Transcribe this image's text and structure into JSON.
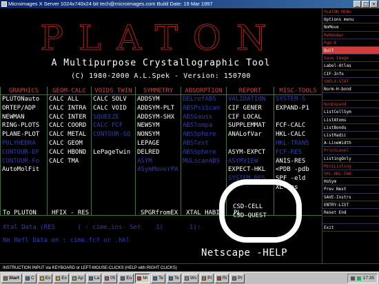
{
  "window": {
    "title": "Microimages X Server   1024x740x24 bit   tech@microimages.com  Build Date: 19 Mar 1997",
    "min": "_",
    "max": "□",
    "close": "×"
  },
  "banner": {
    "title": "PLATON",
    "subtitle": "A Multipurpose Crystallographic Tool",
    "copyright": "(C) 1980-2000 A.L.Spek - Version: 150700"
  },
  "columns": [
    {
      "header": "GRAPHICS",
      "items": [
        {
          "label": "PLUTONauto",
          "dim": false
        },
        {
          "label": "ORTEP/ADP",
          "dim": false
        },
        {
          "label": "NEWMAN",
          "dim": false
        },
        {
          "label": "RING-PLOTS",
          "dim": false
        },
        {
          "label": "PLANE-PLOT",
          "dim": false
        },
        {
          "label": "POLYHEDRA",
          "dim": true
        },
        {
          "label": "CONTOUR-DF",
          "dim": true
        },
        {
          "label": "CONTOUR-Fo",
          "dim": true
        },
        {
          "label": "AutoMolFit",
          "dim": false
        }
      ]
    },
    {
      "header": "GEOM-CALC",
      "items": [
        {
          "label": "CALC ALL",
          "dim": false
        },
        {
          "label": "CALC INTRA",
          "dim": false
        },
        {
          "label": "CALC INTER",
          "dim": false
        },
        {
          "label": "CALC COORD",
          "dim": false
        },
        {
          "label": "CALC METAL",
          "dim": false
        },
        {
          "label": "CALC GEOM",
          "dim": false
        },
        {
          "label": "CALC HBOND",
          "dim": false
        },
        {
          "label": "CALC TMA",
          "dim": false
        }
      ]
    },
    {
      "header": "VOIDS TWIN",
      "items": [
        {
          "label": "CALC SOLV",
          "dim": false
        },
        {
          "label": "CALC VOID",
          "dim": false
        },
        {
          "label": "SQUEEZE",
          "dim": true
        },
        {
          "label": "CALC FCF",
          "dim": true
        },
        {
          "label": "CONTOUR-SQ",
          "dim": true
        },
        {
          "label": "",
          "dim": false
        },
        {
          "label": "LePageTwin",
          "dim": false
        }
      ]
    },
    {
      "header": "SYMMETRY",
      "items": [
        {
          "label": "ADDSYM",
          "dim": false
        },
        {
          "label": "ADDSYM-PLT",
          "dim": false
        },
        {
          "label": "ADDSYM-SHX",
          "dim": false
        },
        {
          "label": "NEWSYM",
          "dim": false
        },
        {
          "label": "NONSYM",
          "dim": false
        },
        {
          "label": "LEPAGE",
          "dim": false
        },
        {
          "label": "DELRED",
          "dim": false
        },
        {
          "label": "ASYM",
          "dim": true
        },
        {
          "label": "ASymMoverPA",
          "dim": true
        }
      ]
    },
    {
      "header": "ABSORPTION",
      "items": [
        {
          "label": "DELrefABS",
          "dim": true
        },
        {
          "label": "ABSPsiScan",
          "dim": true
        },
        {
          "label": "ABSGauss",
          "dim": true
        },
        {
          "label": "ABSTompa",
          "dim": true
        },
        {
          "label": "ABSSphere",
          "dim": true
        },
        {
          "label": "ABSTest",
          "dim": true
        },
        {
          "label": "ABSSphere",
          "dim": true
        },
        {
          "label": "MULscanABS",
          "dim": true
        }
      ]
    },
    {
      "header": "REPORT",
      "items": [
        {
          "label": "VALIDATION",
          "dim": true
        },
        {
          "label": "CIF GENER",
          "dim": false
        },
        {
          "label": "CIF LOCAL",
          "dim": false
        },
        {
          "label": "SUPPLEMMAT",
          "dim": false
        },
        {
          "label": "ANALofVar",
          "dim": false
        },
        {
          "label": "",
          "dim": false
        },
        {
          "label": "ASYM-EXPCT",
          "dim": false
        },
        {
          "label": "ASYMVIEW",
          "dim": true
        },
        {
          "label": "EXPECT-HKL",
          "dim": false
        },
        {
          "label": "SYSTEM-RES",
          "dim": true
        }
      ]
    },
    {
      "header": "MISC-TOOLS",
      "items": [
        {
          "label": "SYSTEM-S",
          "dim": true
        },
        {
          "label": "EXPAND-P1",
          "dim": false
        },
        {
          "label": "",
          "dim": false
        },
        {
          "label": "FCF-CALC",
          "dim": false
        },
        {
          "label": "HKL-CALC",
          "dim": false
        },
        {
          "label": "HKL-TRANS",
          "dim": true
        },
        {
          "label": "FCF-RES",
          "dim": true
        },
        {
          "label": "ANIS-RES",
          "dim": false
        },
        {
          "label": "<PDB  -pdb",
          "dim": false
        },
        {
          "label": "SPF  -eld",
          "dim": false
        },
        {
          "label": "XL-res",
          "dim": false
        }
      ]
    }
  ],
  "bottom": {
    "to_pluton": "To PLUTON",
    "hfix": "HFIX - RES",
    "spgr": "SPGRfromEX",
    "xtal": "XTAL HABIT",
    "csd_cell": "CSD-CELL",
    "csd_quest": "CSD-QUEST",
    "pl_tail": "PL"
  },
  "status": {
    "line1": "Xtal Data (RES      ) : cime.ins- Set    1(       1):",
    "line2": "No Refl Data on : cime.fcf or .hkl",
    "netscape": "Netscape -HELP"
  },
  "sidemenu": [
    {
      "label": "PLATON MENU",
      "style": "red"
    },
    {
      "label": "Options menu",
      "style": ""
    },
    {
      "label": "NoMove",
      "style": ""
    },
    {
      "label": "ReRender",
      "style": "red"
    },
    {
      "label": "Pgm-A",
      "style": "red"
    },
    {
      "label": "Quit",
      "style": "hl"
    },
    {
      "label": "Save Image",
      "style": "red"
    },
    {
      "label": "Label-Atlas",
      "style": ""
    },
    {
      "label": "CIF-Info",
      "style": ""
    },
    {
      "label": "SHELX-STAT",
      "style": "red"
    },
    {
      "label": "Norm-H-bond",
      "style": ""
    },
    {
      "label": "",
      "style": ""
    },
    {
      "label": "NonExpand",
      "style": "red"
    },
    {
      "label": "ListCellSym",
      "style": ""
    },
    {
      "label": "ListAtoms",
      "style": ""
    },
    {
      "label": "ListBonds",
      "style": ""
    },
    {
      "label": "ListRadii",
      "style": ""
    },
    {
      "label": "A-LineWidth",
      "style": ""
    },
    {
      "label": "PrintLevel",
      "style": "red"
    },
    {
      "label": "ListingOnly",
      "style": ""
    },
    {
      "label": "MiniListing",
      "style": "red"
    },
    {
      "label": "SPL-HKL-TAB",
      "style": "red"
    },
    {
      "label": "HoSym",
      "style": ""
    },
    {
      "label": "Prev    Next",
      "style": ""
    },
    {
      "label": "SAVE-Instrs",
      "style": ""
    },
    {
      "label": "ENTRY-LIST",
      "style": ""
    },
    {
      "label": "Reset   End",
      "style": ""
    },
    {
      "label": "",
      "style": ""
    },
    {
      "label": "Exit",
      "style": ""
    }
  ],
  "instruction": "INSTRUCTION INPUT via KEYBOARD or LEFT-MOUSE-CLICKS (HELP with RIGHT CLICKS)",
  "taskbar": {
    "start": "Start",
    "buttons": [
      "C",
      "Ex",
      "Ex",
      "Ap",
      "La",
      "05",
      "Eu",
      "Mi",
      "Te",
      "Te",
      "Ws",
      "Pi",
      "Ri",
      "Pr"
    ],
    "clock": "17:35"
  },
  "colors": {
    "title_outline": "#c81818",
    "menu_header": "#d23c3c",
    "dim_item": "#2b3fb8",
    "grid_line": "#3a7a3a"
  }
}
